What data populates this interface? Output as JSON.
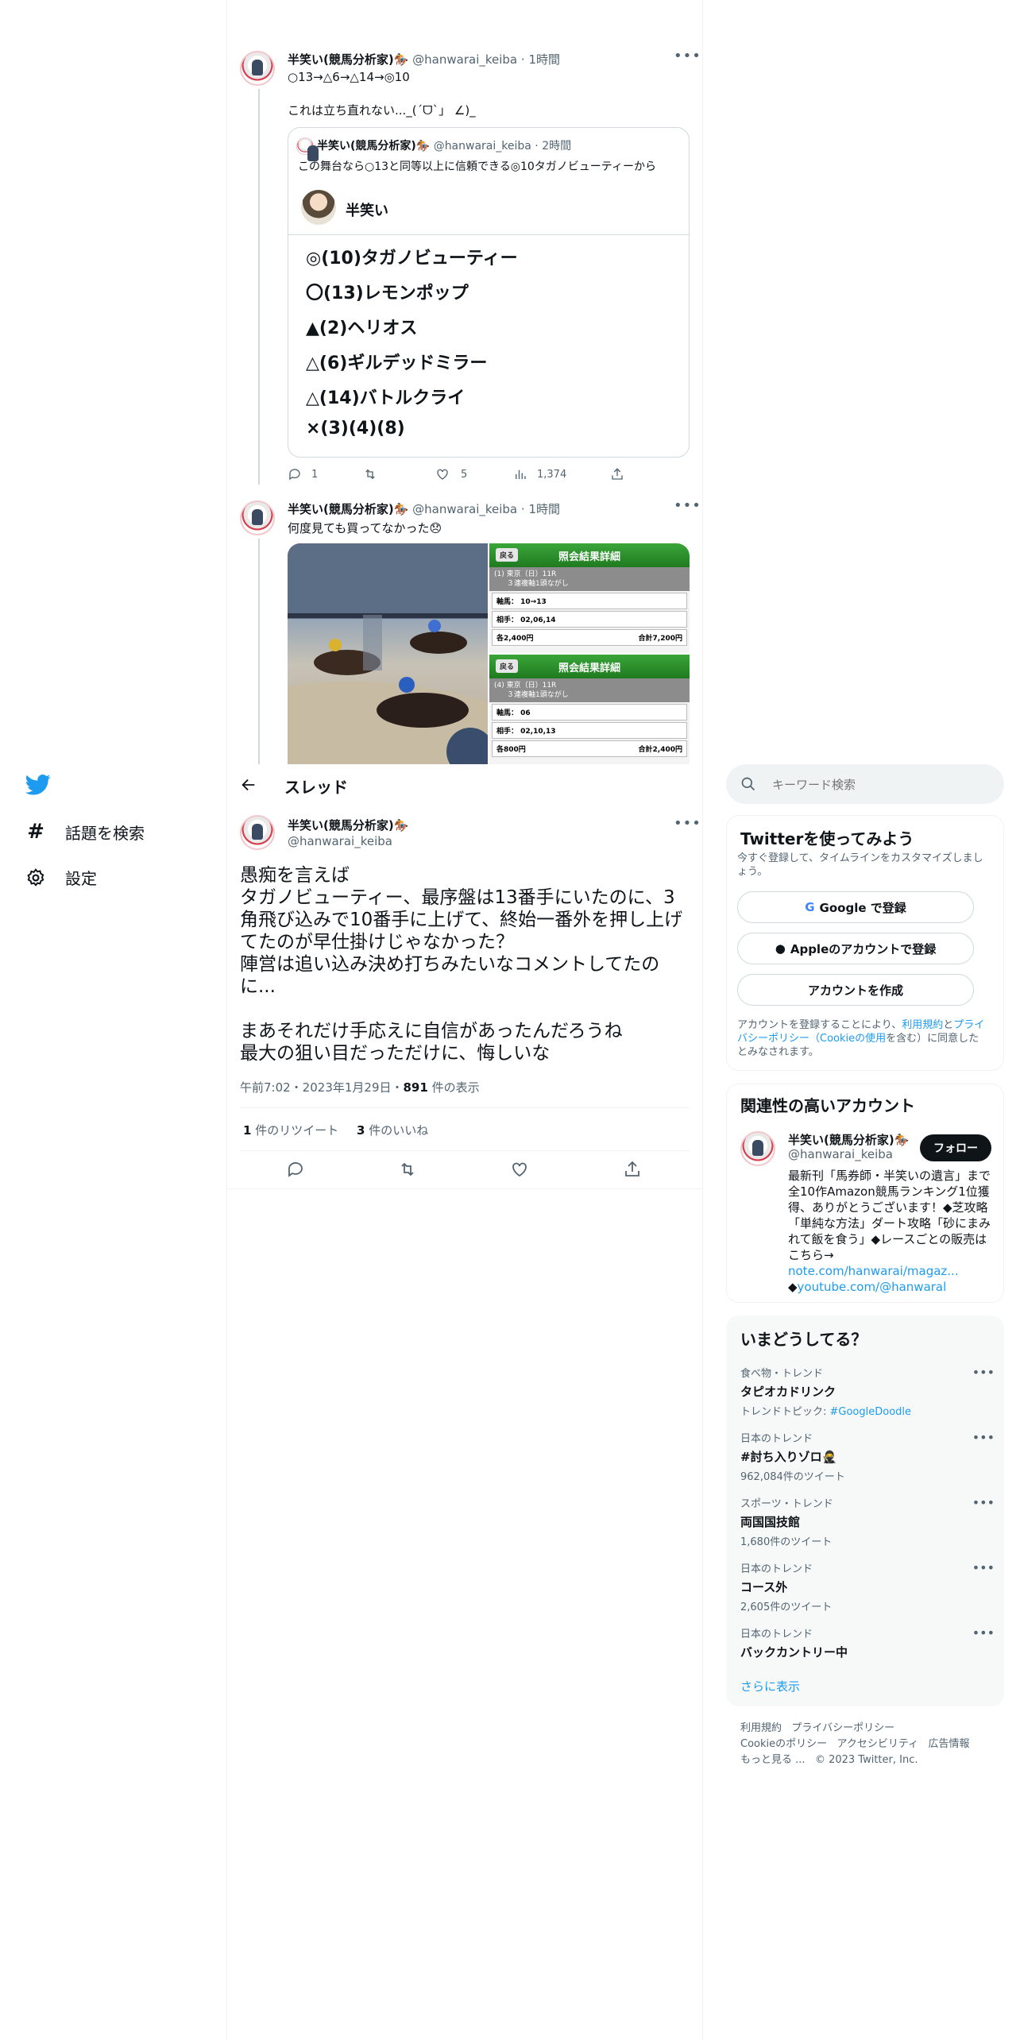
{
  "tweet1": {
    "name": "半笑い(競馬分析家)🏇",
    "handle": "@hanwarai_keiba",
    "time": "1時間",
    "line1": "○13→△6→△14→◎10",
    "line2": "これは立ち直れない..._(ˊᗜˋ」 ∠)_",
    "quote": {
      "name": "半笑い(競馬分析家)🏇",
      "handle": "@hanwarai_keiba",
      "time": "2時間",
      "text": "この舞台なら○13と同等以上に信頼できる◎10タガノビューティーから",
      "card_name": "半笑い",
      "picks": [
        "◎(10)タガノビューティー",
        "〇(13)レモンポップ",
        "▲(2)ヘリオス",
        "△(6)ギルデッドミラー",
        "△(14)バトルクライ",
        "×(3)(4)(8)"
      ]
    },
    "replies": "1",
    "retweets": "",
    "likes": "5",
    "views": "1,374"
  },
  "tweet2": {
    "name": "半笑い(競馬分析家)🏇",
    "handle": "@hanwarai_keiba",
    "time": "1時間",
    "text": "何度見ても買ってなかった😞",
    "result_title": "照会結果詳細",
    "back": "戻る",
    "result1": {
      "race": "(1) 東京（日）11R",
      "bet": "３連複軸1頭ながし",
      "axis": "軸馬： 10→13",
      "partners": "相手： 02,06,14",
      "each": "各2,400円",
      "total": "合計7,200円"
    },
    "result2": {
      "race": "(4) 東京（日）11R",
      "bet": "３連複軸1頭ながし",
      "axis": "軸馬： 06",
      "partners": "相手： 02,10,13",
      "each": "各800円",
      "total": "合計2,400円"
    }
  },
  "header": {
    "title": "スレッド"
  },
  "main_tweet": {
    "name": "半笑い(競馬分析家)🏇",
    "handle": "@hanwarai_keiba",
    "body": "愚痴を言えば\nタガノビューティー、最序盤は13番手にいたのに、3角飛び込みで10番手に上げて、終始一番外を押し上げてたのが早仕掛けじゃなかった？\n陣営は追い込み決め打ちみたいなコメントしてたのに...\n\nまあそれだけ手応えに自信があったんだろうね\n最大の狙い目だっただけに、悔しいな",
    "timestamp": "午前7:02・2023年1月29日・",
    "views_num": "891",
    "views_label": " 件の表示",
    "rt_num": "1",
    "rt_label": " 件のリツイート",
    "like_num": "3",
    "like_label": " 件のいいね"
  },
  "nav": {
    "explore": "話題を検索",
    "settings": "設定"
  },
  "search": {
    "placeholder": "キーワード検索"
  },
  "signup": {
    "title": "Twitterを使ってみよう",
    "subtitle": "今すぐ登録して、タイムラインをカスタマイズしましょう。",
    "google": "Google で登録",
    "apple": "Appleのアカウントで登録",
    "create": "アカウントを作成",
    "legal_a": "アカウントを登録することにより、",
    "legal_terms": "利用規約",
    "legal_and": "と",
    "legal_privacy": "プライバシーポリシー（Cookieの使用",
    "legal_b": "を含む）に同意したとみなされます。"
  },
  "related": {
    "title": "関連性の高いアカウント",
    "name": "半笑い(競馬分析家)🏇",
    "handle": "@hanwarai_keiba",
    "follow": "フォロー",
    "bio": "最新刊「馬券師・半笑いの遺言」まで全10作Amazon競馬ランキング1位獲得、ありがとうございます！◆芝攻略「単純な方法」ダート攻略「砂にまみれて飯を食う」◆レースごとの販売はこちら→",
    "link1": "note.com/hanwarai/magaz...",
    "link2_prefix": "◆",
    "link2": "youtube.com/@hanwaral"
  },
  "trends": {
    "title": "いまどうしてる？",
    "items": [
      {
        "context": "食べ物・トレンド",
        "name": "タピオカドリンク",
        "extra_prefix": "トレンドトピック: ",
        "extra_link": "#GoogleDoodle"
      },
      {
        "context": "日本のトレンド",
        "name": "#討ち入りゾロ🥷",
        "count": "962,084件のツイート"
      },
      {
        "context": "スポーツ・トレンド",
        "name": "両国国技館",
        "count": "1,680件のツイート"
      },
      {
        "context": "日本のトレンド",
        "name": "コース外",
        "count": "2,605件のツイート"
      },
      {
        "context": "日本のトレンド",
        "name": "バックカントリー中"
      }
    ],
    "more": "さらに表示"
  },
  "footer": {
    "terms": "利用規約",
    "privacy": "プライバシーポリシー",
    "cookie": "Cookieのポリシー",
    "accessibility": "アクセシビリティ",
    "ads": "広告情報",
    "more": "もっと見る ...",
    "copyright": "© 2023 Twitter, Inc."
  },
  "colors": {
    "accent": "#1d9bf0",
    "text": "#0f1419",
    "muted": "#536471",
    "border": "#eff3f4"
  }
}
